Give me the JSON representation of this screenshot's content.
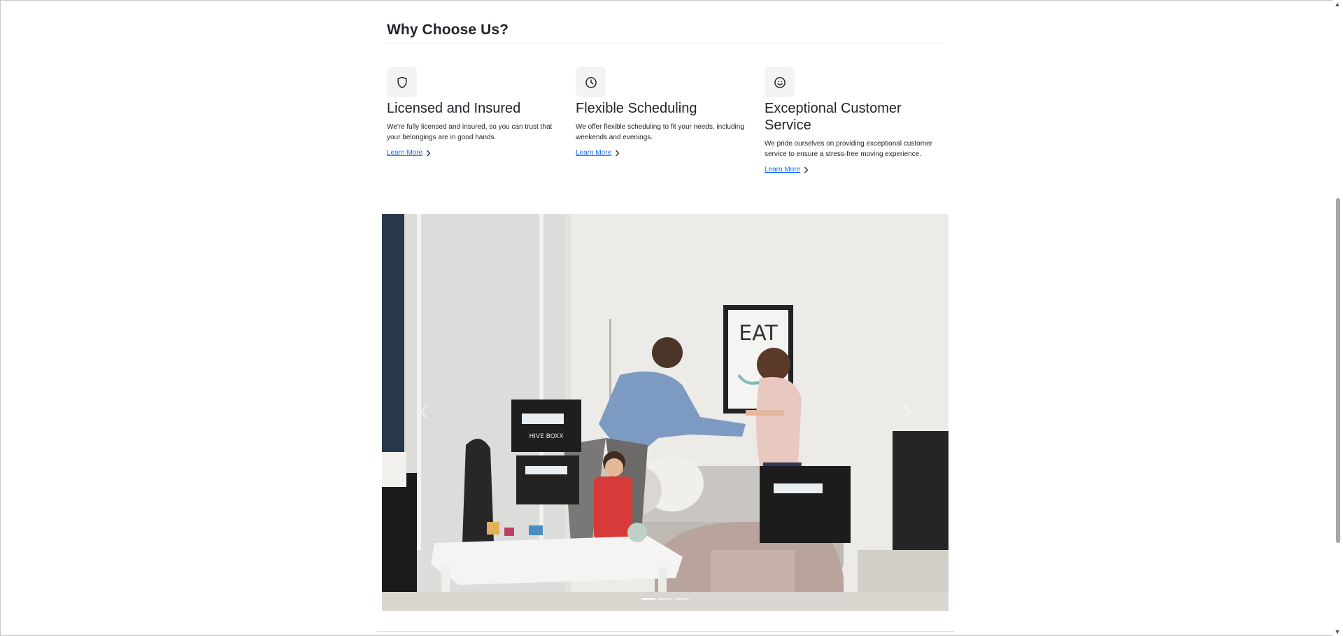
{
  "section": {
    "title": "Why Choose Us?"
  },
  "features": [
    {
      "icon": "shield-icon",
      "title": "Licensed and Insured",
      "text": "We're fully licensed and insured, so you can trust that your belongings are in good hands.",
      "link": "Learn More"
    },
    {
      "icon": "clock-icon",
      "title": "Flexible Scheduling",
      "text": "We offer flexible scheduling to fit your needs, including weekends and evenings.",
      "link": "Learn More"
    },
    {
      "icon": "smile-icon",
      "title": "Exceptional Customer Service",
      "text": "We pride ourselves on providing exceptional customer service to ensure a stress-free moving experience.",
      "link": "Learn More"
    }
  ],
  "carousel": {
    "slide_count": 3,
    "active_index": 0,
    "photo_text": {
      "frame": "EAT",
      "box_label": "HIVE BOXX"
    }
  },
  "colors": {
    "link": "#0d6efd",
    "text": "#212529",
    "rule": "#dee2e6",
    "icon_bg": "#f3f3f3"
  }
}
